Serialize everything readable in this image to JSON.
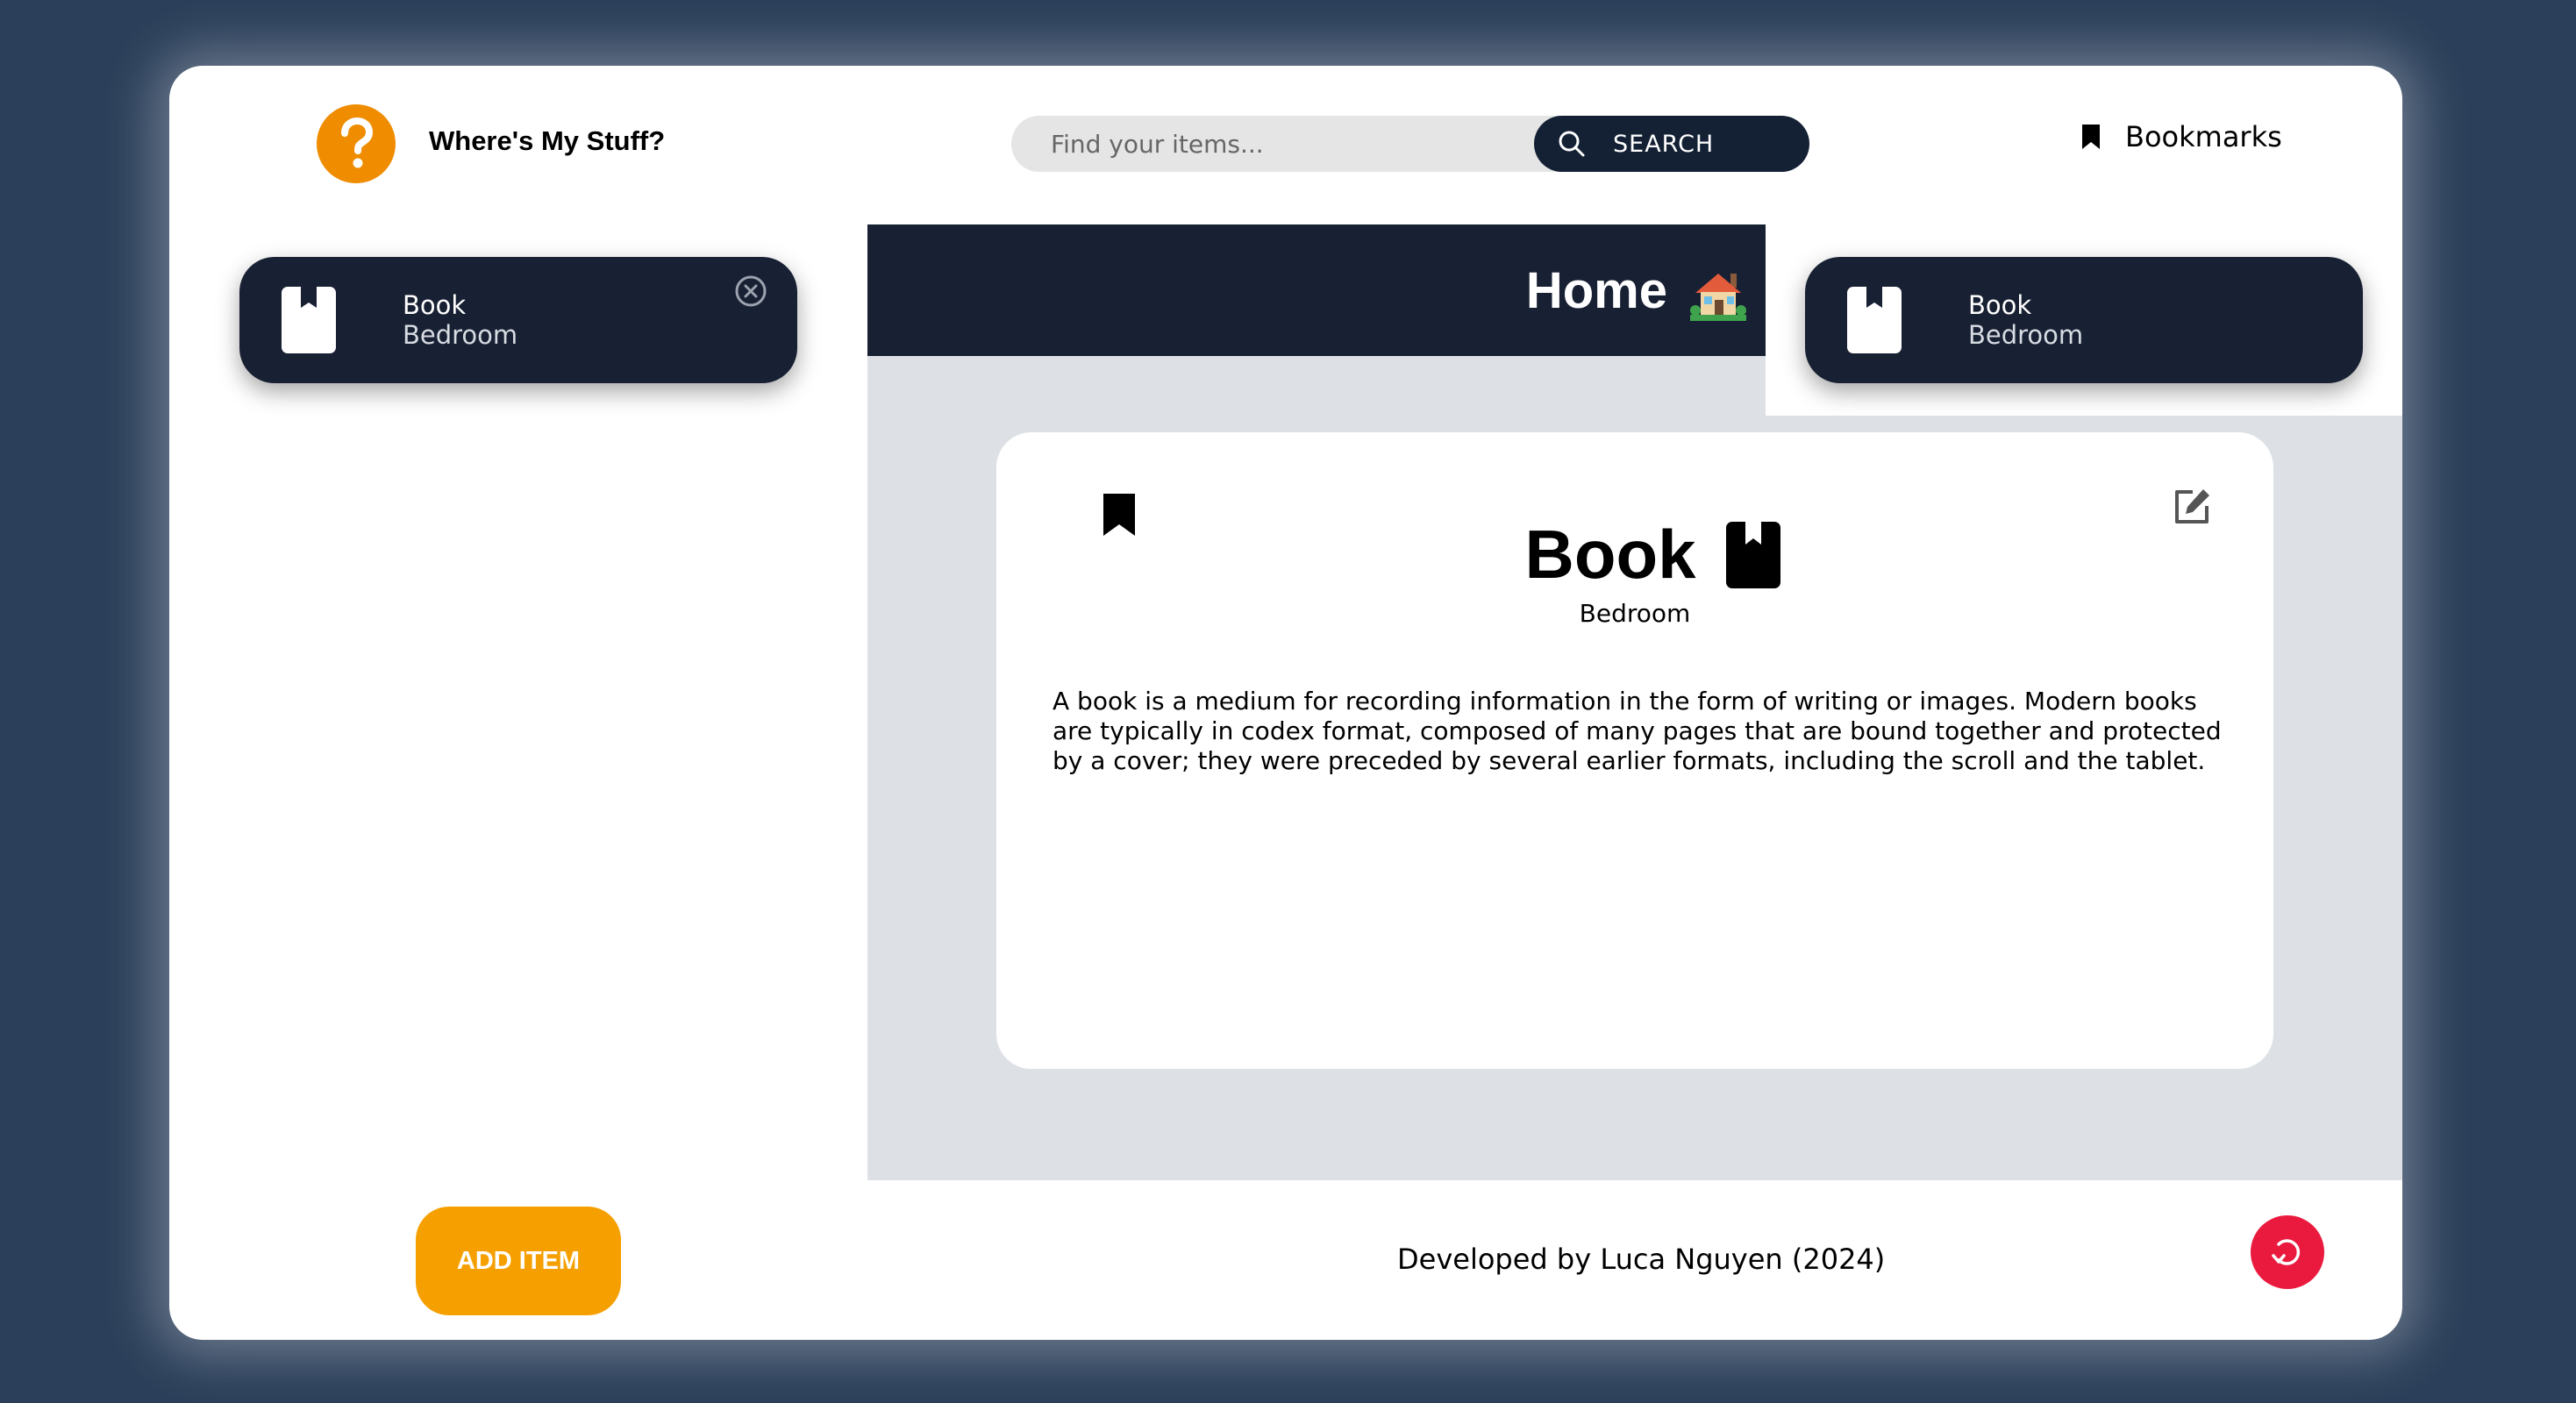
{
  "header": {
    "logo_icon": "question-mark-icon",
    "app_title": "Where's My Stuff?",
    "search": {
      "placeholder": "Find your items...",
      "value": "",
      "button_label": "SEARCH",
      "button_icon": "search-icon"
    },
    "bookmarks": {
      "icon": "bookmark-icon",
      "label": "Bookmarks"
    }
  },
  "recent_items": [
    {
      "name": "Book",
      "room": "Bedroom",
      "icon": "book-icon",
      "remove_icon": "close-circle-icon"
    }
  ],
  "bookmarked_items": [
    {
      "name": "Book",
      "room": "Bedroom",
      "icon": "book-icon"
    }
  ],
  "main": {
    "banner_title": "Home",
    "banner_icon": "house-icon",
    "detail": {
      "title": "Book",
      "room": "Bedroom",
      "description": "A book is a medium for recording information in the form of writing or images. Modern books are typically in codex format, composed of many pages that are bound together and protected by a cover; they were preceded by several earlier formats, including the scroll and the tablet.",
      "bookmark_icon": "bookmark-icon",
      "edit_icon": "edit-icon",
      "title_icon": "book-icon"
    }
  },
  "footer": {
    "add_item_label": "ADD ITEM",
    "credit": "Developed by Luca Nguyen (2024)",
    "refresh_icon": "refresh-icon"
  },
  "colors": {
    "page_background": "#2b3f5a",
    "navy": "#182033",
    "accent_orange": "#f5a000",
    "logo_orange": "#ef8c00",
    "refresh_red": "#ea1a3f",
    "main_panel_gray": "#dde1e6"
  }
}
